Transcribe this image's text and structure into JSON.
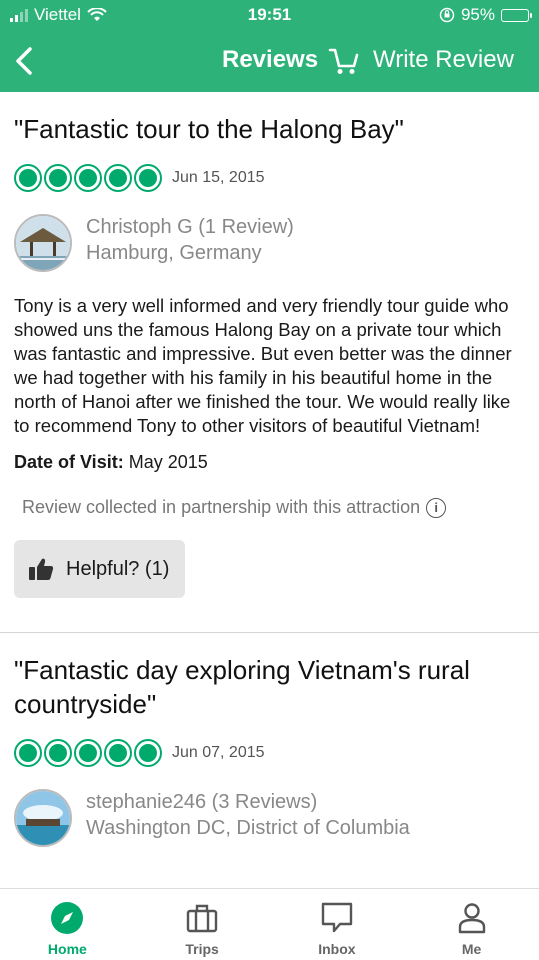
{
  "status_bar": {
    "carrier": "Viettel",
    "time": "19:51",
    "battery": "95%"
  },
  "nav": {
    "title": "Reviews",
    "write_review": "Write Review"
  },
  "reviews": [
    {
      "title": "\"Fantastic tour to the Halong Bay\"",
      "rating": 5,
      "date": "Jun 15, 2015",
      "author": "Christoph G (1 Review)",
      "location": "Hamburg, Germany",
      "body": "Tony is a very well informed and very friendly tour guide who showed uns the famous Halong Bay on a private tour which was fantastic and impressive. But even better was the dinner we had together with his family in his beautiful home in the north of Hanoi after we finished the tour. We would really like to recommend Tony to other visitors of beautiful Vietnam!",
      "visit_label": "Date of Visit:",
      "visit_value": "May 2015",
      "collected": "Review collected in partnership with this attraction",
      "helpful": "Helpful? (1)"
    },
    {
      "title": "\"Fantastic day exploring Vietnam's rural countryside\"",
      "rating": 5,
      "date": "Jun 07, 2015",
      "author": "stephanie246 (3 Reviews)",
      "location": "Washington DC, District of Columbia"
    }
  ],
  "tabs": [
    {
      "label": "Home",
      "icon": "compass-icon",
      "active": true
    },
    {
      "label": "Trips",
      "icon": "suitcase-icon",
      "active": false
    },
    {
      "label": "Inbox",
      "icon": "chat-icon",
      "active": false
    },
    {
      "label": "Me",
      "icon": "person-icon",
      "active": false
    }
  ],
  "colors": {
    "brand": "#2db37a",
    "rating": "#00aa6c"
  }
}
